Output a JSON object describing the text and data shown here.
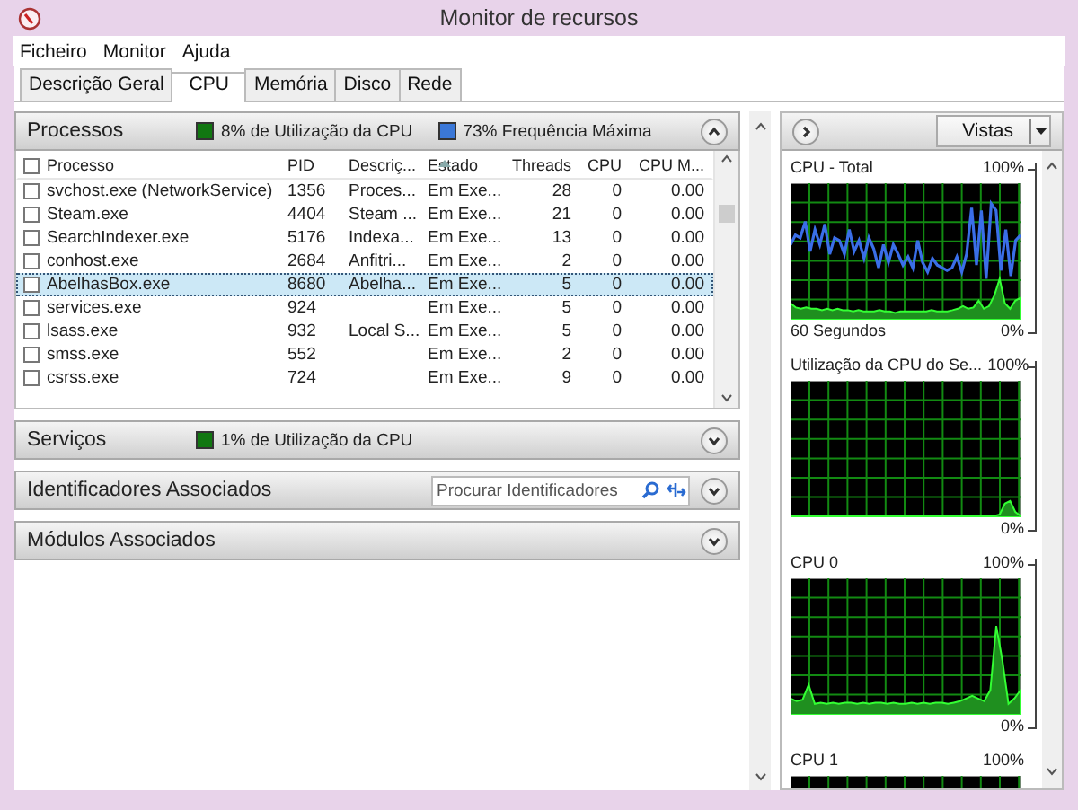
{
  "window": {
    "title": "Monitor de recursos"
  },
  "menu": [
    "Ficheiro",
    "Monitor",
    "Ajuda"
  ],
  "tabs": [
    {
      "label": "Descrição Geral",
      "selected": false
    },
    {
      "label": "CPU",
      "selected": true
    },
    {
      "label": "Memória",
      "selected": false
    },
    {
      "label": "Disco",
      "selected": false
    },
    {
      "label": "Rede",
      "selected": false
    }
  ],
  "sections": [
    {
      "kind": "processes",
      "title": "Processos",
      "expanded": true,
      "select_all_checked": false,
      "badges": [
        {
          "text": "8% de Utilização da CPU",
          "color": "#117711"
        },
        {
          "text": "73% Frequência Máxima",
          "color": "#3b78d8"
        }
      ],
      "columns": [
        {
          "label": "Processo",
          "sorted": false
        },
        {
          "label": "PID",
          "sorted": false
        },
        {
          "label": "Descriç...",
          "sorted": false
        },
        {
          "label": "Estado",
          "sorted": true
        },
        {
          "label": "Threads",
          "sorted": false
        },
        {
          "label": "CPU",
          "sorted": false
        },
        {
          "label": "CPU M...",
          "sorted": false
        }
      ],
      "rows": [
        {
          "name": "svchost.exe (NetworkService)",
          "pid": "1356",
          "description": "Proces...",
          "status": "Em Exe...",
          "threads": "28",
          "cpu": "0",
          "cpu_avg": "0.00",
          "checked": false,
          "selected": false
        },
        {
          "name": "Steam.exe",
          "pid": "4404",
          "description": "Steam ...",
          "status": "Em Exe...",
          "threads": "21",
          "cpu": "0",
          "cpu_avg": "0.00",
          "checked": false,
          "selected": false
        },
        {
          "name": "SearchIndexer.exe",
          "pid": "5176",
          "description": "Indexa...",
          "status": "Em Exe...",
          "threads": "13",
          "cpu": "0",
          "cpu_avg": "0.00",
          "checked": false,
          "selected": false
        },
        {
          "name": "conhost.exe",
          "pid": "2684",
          "description": "Anfitri...",
          "status": "Em Exe...",
          "threads": "2",
          "cpu": "0",
          "cpu_avg": "0.00",
          "checked": false,
          "selected": false
        },
        {
          "name": "AbelhasBox.exe",
          "pid": "8680",
          "description": "Abelha...",
          "status": "Em Exe...",
          "threads": "5",
          "cpu": "0",
          "cpu_avg": "0.00",
          "checked": false,
          "selected": true
        },
        {
          "name": "services.exe",
          "pid": "924",
          "status": "Em Exe...",
          "threads": "5",
          "cpu": "0",
          "cpu_avg": "0.00",
          "checked": false,
          "selected": false
        },
        {
          "name": "lsass.exe",
          "pid": "932",
          "description": "Local S...",
          "status": "Em Exe...",
          "threads": "5",
          "cpu": "0",
          "cpu_avg": "0.00",
          "checked": false,
          "selected": false
        },
        {
          "name": "smss.exe",
          "pid": "552",
          "status": "Em Exe...",
          "threads": "2",
          "cpu": "0",
          "cpu_avg": "0.00",
          "checked": false,
          "selected": false
        },
        {
          "name": "csrss.exe",
          "pid": "724",
          "status": "Em Exe...",
          "threads": "9",
          "cpu": "0",
          "cpu_avg": "0.00",
          "checked": false,
          "selected": false
        }
      ]
    },
    {
      "kind": "services",
      "title": "Serviços",
      "expanded": false,
      "badges": [
        {
          "text": "1% de Utilização da CPU",
          "color": "#117711"
        }
      ]
    },
    {
      "kind": "handles",
      "title": "Identificadores Associados",
      "expanded": false,
      "search": {
        "placeholder": "Procurar Identificadores"
      }
    },
    {
      "kind": "modules",
      "title": "Módulos Associados",
      "expanded": false
    }
  ],
  "graph_panel": {
    "views_button": "Vistas",
    "graphs": [
      {
        "title": "CPU - Total",
        "max": "100%",
        "footer": "60 Segundos",
        "min": "0%"
      },
      {
        "title": "Utilização da CPU do Se...",
        "max": "100%",
        "min": "0%"
      },
      {
        "title": "CPU 0",
        "max": "100%",
        "min": "0%"
      },
      {
        "title": "CPU 1",
        "max": "100%"
      }
    ]
  }
}
